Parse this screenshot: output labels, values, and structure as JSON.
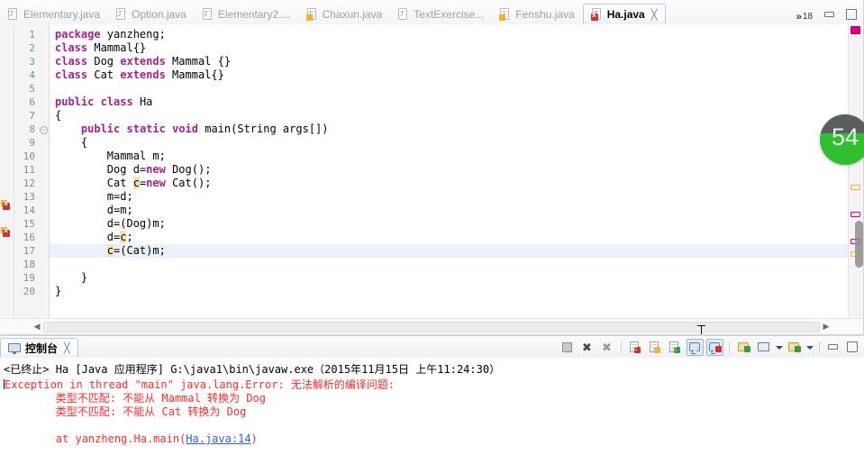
{
  "window": {
    "minimize_label": "Minimize",
    "maximize_label": "Maximize"
  },
  "editor": {
    "tabs": [
      {
        "label": "Elementary.java",
        "icon": "java-file-icon",
        "state": "normal",
        "active": false
      },
      {
        "label": "Option.java",
        "icon": "java-file-icon",
        "state": "normal",
        "active": false
      },
      {
        "label": "Elementary2....",
        "icon": "java-file-icon",
        "state": "normal",
        "active": false
      },
      {
        "label": "Chaxun.java",
        "icon": "java-file-warning-icon",
        "state": "warning",
        "active": false
      },
      {
        "label": "TextExercise...",
        "icon": "java-file-icon",
        "state": "normal",
        "active": false
      },
      {
        "label": "Fenshu.java",
        "icon": "java-file-warning-icon",
        "state": "warning",
        "active": false
      },
      {
        "label": "Ha.java",
        "icon": "java-file-error-icon",
        "state": "error",
        "active": true
      }
    ],
    "overflow_chevron": "»",
    "overflow_count": "18",
    "close_glyph": "╳",
    "lines": [
      {
        "n": "1",
        "fold": "",
        "marker": "",
        "current": false,
        "tokens": [
          {
            "t": "package",
            "c": "kw"
          },
          {
            "t": " yanzheng;",
            "c": ""
          }
        ]
      },
      {
        "n": "2",
        "fold": "",
        "marker": "",
        "current": false,
        "tokens": [
          {
            "t": "class",
            "c": "kw"
          },
          {
            "t": " Mammal{}",
            "c": ""
          }
        ]
      },
      {
        "n": "3",
        "fold": "",
        "marker": "",
        "current": false,
        "tokens": [
          {
            "t": "class",
            "c": "kw"
          },
          {
            "t": " Dog ",
            "c": ""
          },
          {
            "t": "extends",
            "c": "kw"
          },
          {
            "t": " Mammal {}",
            "c": ""
          }
        ]
      },
      {
        "n": "4",
        "fold": "",
        "marker": "",
        "current": false,
        "tokens": [
          {
            "t": "class",
            "c": "kw"
          },
          {
            "t": " Cat ",
            "c": ""
          },
          {
            "t": "extends",
            "c": "kw"
          },
          {
            "t": " Mammal{}",
            "c": ""
          }
        ]
      },
      {
        "n": "5",
        "fold": "",
        "marker": "",
        "current": false,
        "tokens": [
          {
            "t": "",
            "c": ""
          }
        ]
      },
      {
        "n": "6",
        "fold": "",
        "marker": "",
        "current": false,
        "tokens": [
          {
            "t": "public",
            "c": "kw"
          },
          {
            "t": " ",
            "c": ""
          },
          {
            "t": "class",
            "c": "kw"
          },
          {
            "t": " Ha",
            "c": ""
          }
        ]
      },
      {
        "n": "7",
        "fold": "",
        "marker": "",
        "current": false,
        "tokens": [
          {
            "t": "{",
            "c": ""
          }
        ]
      },
      {
        "n": "8",
        "fold": "minus",
        "marker": "",
        "current": false,
        "tokens": [
          {
            "t": "    ",
            "c": ""
          },
          {
            "t": "public",
            "c": "kw"
          },
          {
            "t": " ",
            "c": ""
          },
          {
            "t": "static",
            "c": "kw"
          },
          {
            "t": " ",
            "c": ""
          },
          {
            "t": "void",
            "c": "kw"
          },
          {
            "t": " main(String args[])",
            "c": ""
          }
        ]
      },
      {
        "n": "9",
        "fold": "",
        "marker": "",
        "current": false,
        "tokens": [
          {
            "t": "    {",
            "c": ""
          }
        ]
      },
      {
        "n": "10",
        "fold": "",
        "marker": "",
        "current": false,
        "tokens": [
          {
            "t": "        Mammal m;",
            "c": ""
          }
        ]
      },
      {
        "n": "11",
        "fold": "",
        "marker": "",
        "current": false,
        "tokens": [
          {
            "t": "        Dog d=",
            "c": ""
          },
          {
            "t": "new",
            "c": "kw"
          },
          {
            "t": " Dog();",
            "c": ""
          }
        ]
      },
      {
        "n": "12",
        "fold": "",
        "marker": "",
        "current": false,
        "tokens": [
          {
            "t": "        Cat ",
            "c": ""
          },
          {
            "t": "c",
            "c": "occ"
          },
          {
            "t": "=",
            "c": ""
          },
          {
            "t": "new",
            "c": "kw"
          },
          {
            "t": " Cat();",
            "c": ""
          }
        ]
      },
      {
        "n": "13",
        "fold": "",
        "marker": "",
        "current": false,
        "tokens": [
          {
            "t": "        m=d;",
            "c": ""
          }
        ]
      },
      {
        "n": "14",
        "fold": "",
        "marker": "error",
        "current": false,
        "tokens": [
          {
            "t": "        d=m;",
            "c": ""
          }
        ]
      },
      {
        "n": "15",
        "fold": "",
        "marker": "",
        "current": false,
        "tokens": [
          {
            "t": "        d=(Dog)m;",
            "c": ""
          }
        ]
      },
      {
        "n": "16",
        "fold": "",
        "marker": "error",
        "current": false,
        "tokens": [
          {
            "t": "        d=",
            "c": ""
          },
          {
            "t": "c",
            "c": "occ"
          },
          {
            "t": ";",
            "c": ""
          }
        ]
      },
      {
        "n": "17",
        "fold": "",
        "marker": "",
        "current": true,
        "tokens": [
          {
            "t": "        ",
            "c": ""
          },
          {
            "t": "c",
            "c": "occ"
          },
          {
            "t": "=(Cat)m;",
            "c": ""
          }
        ]
      },
      {
        "n": "18",
        "fold": "",
        "marker": "",
        "current": false,
        "tokens": [
          {
            "t": "",
            "c": ""
          }
        ]
      },
      {
        "n": "19",
        "fold": "",
        "marker": "",
        "current": false,
        "tokens": [
          {
            "t": "    }",
            "c": ""
          }
        ]
      },
      {
        "n": "20",
        "fold": "",
        "marker": "",
        "current": false,
        "tokens": [
          {
            "t": "}",
            "c": ""
          }
        ]
      }
    ],
    "badge": {
      "value": "54",
      "label": "code-review-badge"
    },
    "scroll_left_arrow": "◀",
    "scroll_right_arrow": "▶"
  },
  "console": {
    "tab_label": "控制台",
    "tab_close_glyph": "╳",
    "toolbar": [
      {
        "name": "terminate-button",
        "icon": "stop-square-icon",
        "pressed": false
      },
      {
        "name": "remove-launch-button",
        "icon": "remove-x-icon",
        "pressed": false
      },
      {
        "name": "remove-all-terminated-button",
        "icon": "remove-all-x-icon",
        "pressed": false
      },
      {
        "name": "clear-console-button",
        "icon": "clear-console-icon",
        "pressed": false
      },
      {
        "name": "scroll-lock-button",
        "icon": "scroll-lock-icon",
        "pressed": false
      },
      {
        "name": "word-wrap-button",
        "icon": "word-wrap-icon",
        "pressed": false
      },
      {
        "name": "show-console-on-output-button",
        "icon": "console-output-icon",
        "pressed": true
      },
      {
        "name": "show-console-on-error-button",
        "icon": "console-error-icon",
        "pressed": true
      },
      {
        "name": "pin-console-button",
        "icon": "pin-console-icon",
        "pressed": false
      },
      {
        "name": "display-selected-console-button",
        "icon": "display-console-icon",
        "pressed": false
      },
      {
        "name": "open-console-button",
        "icon": "open-console-icon",
        "pressed": false
      }
    ],
    "output": [
      {
        "kind": "header",
        "text": "<已终止> Ha [Java 应用程序] G:\\java1\\bin\\javaw.exe（2015年11月15日 上午11:24:30）"
      },
      {
        "kind": "error",
        "text": "Exception in thread \"main\" java.lang.Error: 无法解析的编译问题:"
      },
      {
        "kind": "error",
        "text": "        类型不匹配: 不能从 Mammal 转换为 Dog"
      },
      {
        "kind": "error",
        "text": "        类型不匹配: 不能从 Cat 转换为 Dog"
      },
      {
        "kind": "error",
        "text": ""
      },
      {
        "kind": "trace",
        "prefix": "        at yanzheng.Ha.main(",
        "link": "Ha.java:14",
        "suffix": ")"
      }
    ]
  },
  "colors": {
    "keyword": "#a2238d",
    "error_text": "#ff2a2a",
    "link": "#2a5fd6",
    "badge_green": "#2fbf2f",
    "badge_grey": "#5b5e60",
    "current_line": "#eaf1fb",
    "tab_border": "#b6cbe4"
  }
}
